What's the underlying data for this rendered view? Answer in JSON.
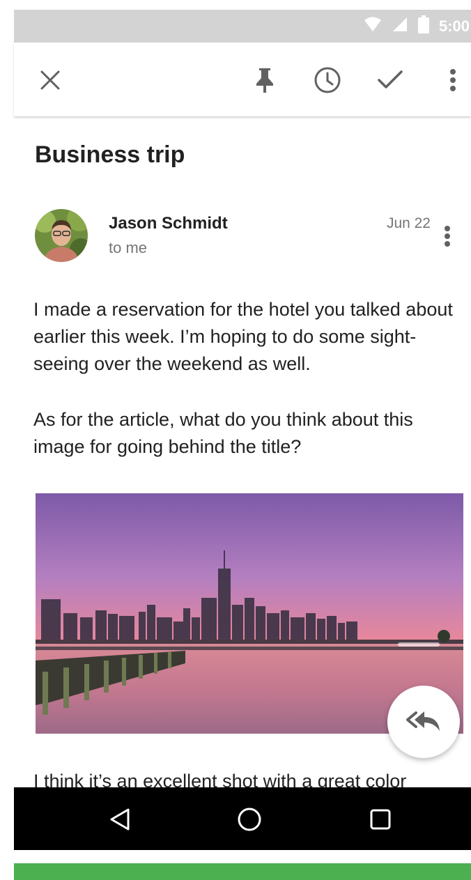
{
  "status_bar": {
    "time": "5:00",
    "icons": [
      "wifi-icon",
      "signal-icon",
      "battery-icon"
    ]
  },
  "toolbar": {
    "icons": [
      "close-icon",
      "pin-icon",
      "snooze-clock-icon",
      "done-check-icon",
      "more-vert-icon"
    ]
  },
  "email": {
    "subject": "Business trip",
    "sender": "Jason Schmidt",
    "recipient": "to me",
    "date": "Jun 22",
    "paragraphs": [
      "I made a reservation for the hotel you talked about earlier this week. I’m hoping to do some sight-seeing over the weekend as well.",
      "As for the article, what do you think about this image for going behind the title?",
      "I think it’s an excellent shot with a great color"
    ]
  },
  "fab": {
    "icon": "reply-all-icon"
  },
  "nav_bar": {
    "icons": [
      "back-triangle-icon",
      "home-circle-icon",
      "recents-square-icon"
    ]
  },
  "colors": {
    "status_bar": "#d3d3d3",
    "accent_strip": "#4caf50",
    "nav_bar": "#000000",
    "icon_gray": "#616161"
  }
}
